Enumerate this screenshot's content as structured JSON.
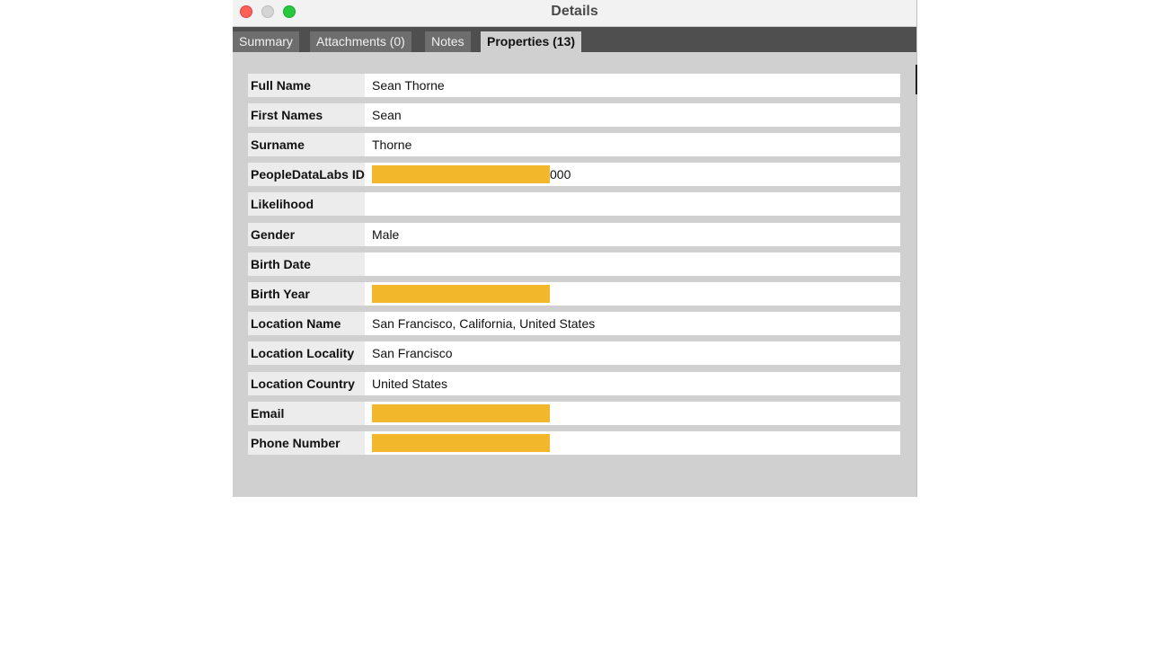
{
  "window": {
    "title": "Details"
  },
  "tabs": [
    {
      "label": "Summary",
      "active": false
    },
    {
      "label": "Attachments (0)",
      "active": false
    },
    {
      "label": "Notes",
      "active": false
    },
    {
      "label": "Properties (13)",
      "active": true
    }
  ],
  "properties": [
    {
      "key": "Full Name",
      "value": "Sean Thorne"
    },
    {
      "key": "First Names",
      "value": "Sean"
    },
    {
      "key": "Surname",
      "value": "Thorne"
    },
    {
      "key": "PeopleDataLabs ID",
      "value": "000",
      "redacted": true
    },
    {
      "key": "Likelihood",
      "value": ""
    },
    {
      "key": "Gender",
      "value": "Male"
    },
    {
      "key": "Birth Date",
      "value": ""
    },
    {
      "key": "Birth Year",
      "value": "",
      "redacted": true
    },
    {
      "key": "Location Name",
      "value": "San Francisco, California, United States"
    },
    {
      "key": "Location Locality",
      "value": "San Francisco"
    },
    {
      "key": "Location Country",
      "value": "United States"
    },
    {
      "key": "Email",
      "value": "",
      "redacted": true
    },
    {
      "key": "Phone Number",
      "value": "",
      "redacted": true
    }
  ],
  "colors": {
    "redaction": "#f2b72a",
    "close": "#fe5f57",
    "minimize": "#d4d4d4",
    "maximize": "#28c840"
  }
}
